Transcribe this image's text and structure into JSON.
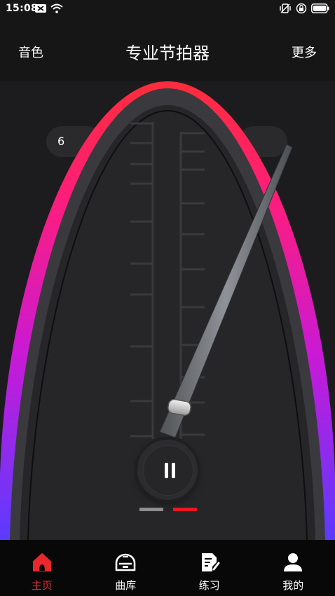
{
  "status_bar": {
    "time": "15:08"
  },
  "header": {
    "tone_label": "音色",
    "title": "专业节拍器",
    "more_label": "更多"
  },
  "metronome": {
    "bpm_partial": "6",
    "accent_gradient": [
      "#ff2d3a",
      "#ff1d7a",
      "#c81ad6",
      "#5b3bff"
    ],
    "pendulum_state": "playing",
    "play_state": "pause"
  },
  "pager": {
    "pages": 2,
    "active_index": 1,
    "inactive_color": "#8e8e8e",
    "active_color": "#e8181f"
  },
  "tabs": [
    {
      "label": "主页",
      "icon": "home-icon",
      "active": true
    },
    {
      "label": "曲库",
      "icon": "library-icon",
      "active": false
    },
    {
      "label": "练习",
      "icon": "practice-icon",
      "active": false
    },
    {
      "label": "我的",
      "icon": "profile-icon",
      "active": false
    }
  ],
  "colors": {
    "active_tab": "#e8282d",
    "background": "#1c1c1e"
  }
}
